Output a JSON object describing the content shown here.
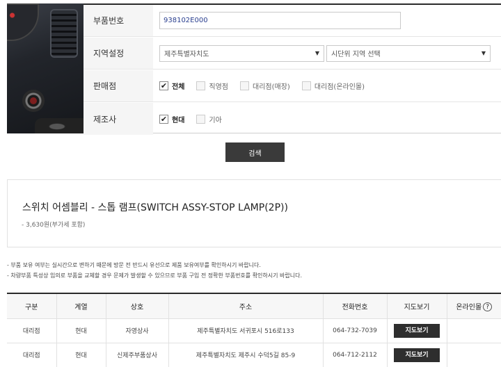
{
  "form": {
    "part_number": {
      "label": "부품번호",
      "value": "938102E000"
    },
    "region": {
      "label": "지역설정",
      "province": "제주특별자치도",
      "city": "시단위 지역 선택"
    },
    "seller": {
      "label": "판매점",
      "options": [
        {
          "label": "전체",
          "checked": true
        },
        {
          "label": "직영점",
          "checked": false
        },
        {
          "label": "대리점(매장)",
          "checked": false
        },
        {
          "label": "대리점(온라인몰)",
          "checked": false
        }
      ]
    },
    "maker": {
      "label": "제조사",
      "options": [
        {
          "label": "현대",
          "checked": true
        },
        {
          "label": "기아",
          "checked": false
        }
      ]
    },
    "search_label": "검색"
  },
  "result": {
    "title": "스위치 어셈블리 - 스톱 램프(SWITCH ASSY-STOP LAMP(2P))",
    "price": "- 3,630원(부가세 포함)"
  },
  "notes": [
    "- 부품 보유 여부는 실시간으로 변하기 때문에 방문 전 반드시 유선으로 제품 보유여부를 확인하시기 바랍니다.",
    "- 차량부품 특성상 임의로 부품을 교체할 경우 문제가 발생할 수 있으므로 부품 구입 전 정확한 부품번호를 확인하시기 바랍니다."
  ],
  "table": {
    "headers": [
      "구분",
      "계열",
      "상호",
      "주소",
      "전화번호",
      "지도보기",
      "온라인몰"
    ],
    "help_glyph": "?",
    "map_button_label": "지도보기",
    "rows": [
      {
        "type": "대리점",
        "brand": "현대",
        "name": "자영상사",
        "address": "제주특별자치도 서귀포시 516로133",
        "phone": "064-732-7039",
        "online": ""
      },
      {
        "type": "대리점",
        "brand": "현대",
        "name": "신제주부품상사",
        "address": "제주특별자치도 제주시 수덕5길 85-9",
        "phone": "064-712-2112",
        "online": ""
      }
    ]
  },
  "icons": {
    "checkmark": "✔",
    "caret": "▼"
  }
}
